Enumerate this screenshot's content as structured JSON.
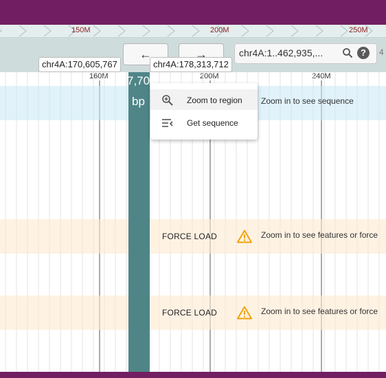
{
  "overview": {
    "labels": [
      "150M",
      "200M",
      "250M"
    ]
  },
  "header": {
    "back_label": "←",
    "forward_label": "→",
    "location_value": "chr4A:1..462,935,...",
    "help_label": "?",
    "truncated": "4"
  },
  "ruler": {
    "ticks": [
      "160M",
      "200M",
      "240M"
    ]
  },
  "selection": {
    "size_partial": "7,70",
    "unit": "bp"
  },
  "coordinates": {
    "left": "chr4A:170,605,767",
    "right": "chr4A:178,313,712"
  },
  "menu": {
    "items": [
      {
        "label": "Zoom to region",
        "icon": "zoom-in-icon"
      },
      {
        "label": "Get sequence",
        "icon": "subject-icon"
      }
    ]
  },
  "tracks": {
    "sequence_message": "Zoom in to see sequence",
    "feature_tracks": [
      {
        "force_label": "FORCE LOAD",
        "message": "Zoom in to see features or force"
      },
      {
        "force_label": "FORCE LOAD",
        "message": "Zoom in to see features or force"
      }
    ]
  },
  "colors": {
    "brand": "#721e63",
    "selection": "#4f8587",
    "warning": "#f0a30a",
    "sequence_bg": "#c8e8f6",
    "feature_bg": "#fde9d1"
  }
}
